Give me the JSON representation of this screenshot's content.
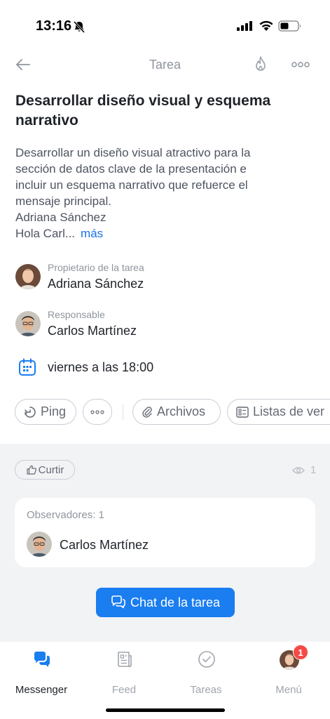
{
  "status_bar": {
    "time": "13:16"
  },
  "nav": {
    "title": "Tarea"
  },
  "task": {
    "title": "Desarrollar diseño visual y esquema narrativo",
    "description_lines": [
      "Desarrollar un diseño visual atractivo para la",
      "sección de datos clave de la presentación e",
      "incluir un esquema narrativo que refuerce el",
      "mensaje principal.",
      "Adriana Sánchez"
    ],
    "description_truncated": "Hola Carl...",
    "more_label": "más"
  },
  "owner": {
    "role": "Propietario de la tarea",
    "name": "Adriana Sánchez"
  },
  "assignee": {
    "role": "Responsable",
    "name": "Carlos Martínez"
  },
  "deadline": {
    "text": "viernes a las 18:00"
  },
  "chips": {
    "ping": "Ping",
    "files": "Archivos",
    "checklists": "Listas de ver"
  },
  "reactions": {
    "like_label": "Curtir",
    "views_count": "1"
  },
  "observers": {
    "label": "Observadores: 1",
    "items": [
      "Carlos Martínez"
    ]
  },
  "chat_button": {
    "label": "Chat de la tarea"
  },
  "tabbar": {
    "messenger": "Messenger",
    "feed": "Feed",
    "tasks": "Tareas",
    "menu": "Menú",
    "menu_badge": "1"
  },
  "colors": {
    "accent": "#1a7df0",
    "link": "#1a73e8",
    "badge": "#f54a45",
    "gray_bg": "#f2f3f5"
  }
}
